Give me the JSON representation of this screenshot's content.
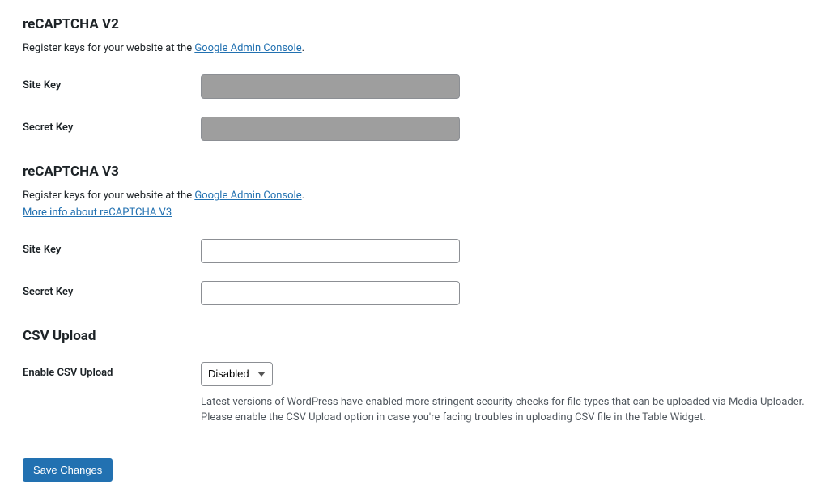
{
  "recaptcha_v2": {
    "heading": "reCAPTCHA V2",
    "desc_prefix": "Register keys for your website at the ",
    "link_text": "Google Admin Console",
    "desc_suffix": ".",
    "site_key_label": "Site Key",
    "site_key_value": "",
    "secret_key_label": "Secret Key",
    "secret_key_value": ""
  },
  "recaptcha_v3": {
    "heading": "reCAPTCHA V3",
    "desc_prefix": "Register keys for your website at the ",
    "link_text": "Google Admin Console",
    "desc_suffix": ".",
    "more_link": "More info about reCAPTCHA V3",
    "site_key_label": "Site Key",
    "site_key_value": "",
    "secret_key_label": "Secret Key",
    "secret_key_value": ""
  },
  "csv_upload": {
    "heading": "CSV Upload",
    "enable_label": "Enable CSV Upload",
    "selected": "Disabled",
    "help": "Latest versions of WordPress have enabled more stringent security checks for file types that can be uploaded via Media Uploader. Please enable the CSV Upload option in case you're facing troubles in uploading CSV file in the Table Widget."
  },
  "actions": {
    "save_label": "Save Changes"
  }
}
